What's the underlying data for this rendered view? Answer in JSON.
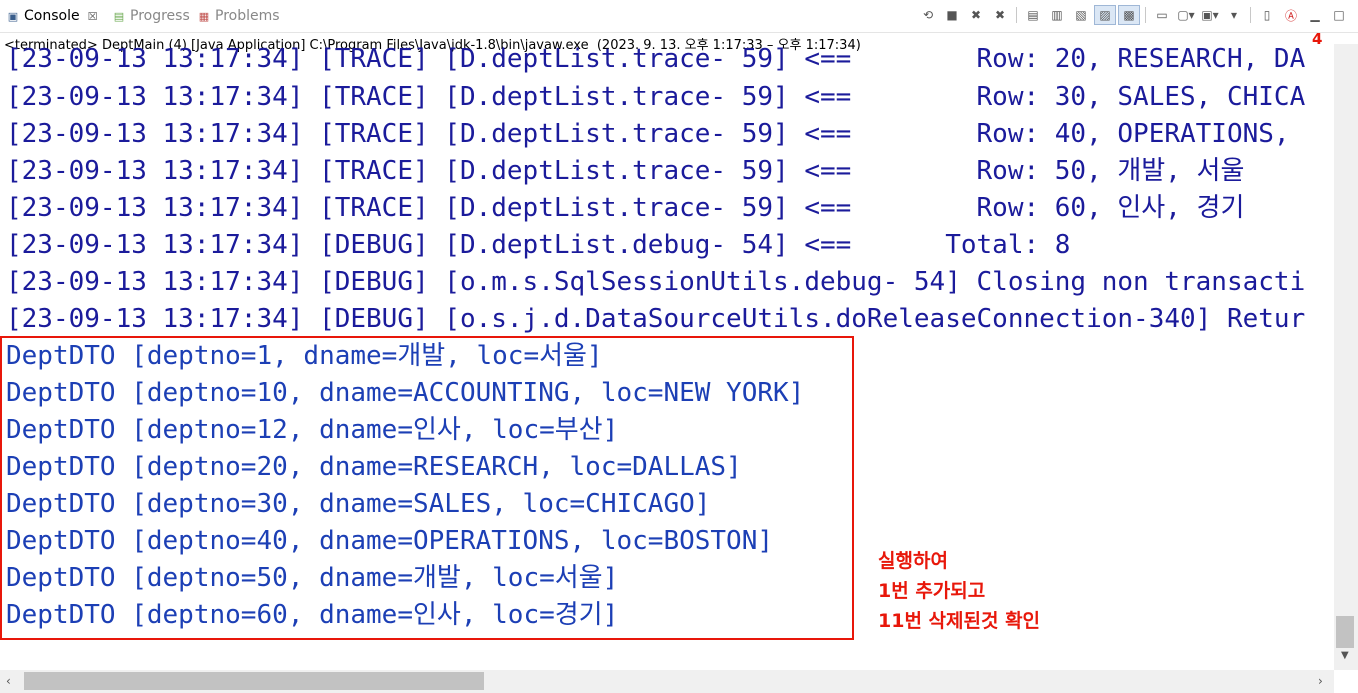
{
  "tabs": [
    {
      "label": "Console",
      "icon": "console-icon",
      "active": true
    },
    {
      "label": "Progress",
      "icon": "progress-icon",
      "active": false
    },
    {
      "label": "Problems",
      "icon": "problems-icon",
      "active": false
    }
  ],
  "close_glyph": "☒",
  "status_line": "<terminated> DeptMain (4) [Java Application] C:\\Program Files\\Java\\jdk-1.8\\bin\\javaw.exe  (2023. 9. 13. 오후 1:17:33 – 오후 1:17:34)",
  "badge": "4",
  "toolbar_icons": [
    "pin-icon",
    "stop-icon",
    "remove-launch-icon",
    "remove-all-icon",
    "scroll-lock-icon",
    "word-wrap-icon",
    "show-stdout-icon",
    "show-stderr-icon",
    "open-console-icon",
    "display-console-icon",
    "new-console-icon",
    "view-menu-icon",
    "minimize-icon",
    "maximize-icon"
  ],
  "log_lines": [
    "[23-09-13 13:17:34] [TRACE] [D.deptList.trace- 59] <==        Row: 20, RESEARCH, DA",
    "[23-09-13 13:17:34] [TRACE] [D.deptList.trace- 59] <==        Row: 30, SALES, CHICA",
    "[23-09-13 13:17:34] [TRACE] [D.deptList.trace- 59] <==        Row: 40, OPERATIONS, ",
    "[23-09-13 13:17:34] [TRACE] [D.deptList.trace- 59] <==        Row: 50, 개발, 서울",
    "[23-09-13 13:17:34] [TRACE] [D.deptList.trace- 59] <==        Row: 60, 인사, 경기",
    "[23-09-13 13:17:34] [DEBUG] [D.deptList.debug- 54] <==      Total: 8",
    "[23-09-13 13:17:34] [DEBUG] [o.m.s.SqlSessionUtils.debug- 54] Closing non transacti",
    "[23-09-13 13:17:34] [DEBUG] [o.s.j.d.DataSourceUtils.doReleaseConnection-340] Retur"
  ],
  "output_lines": [
    "DeptDTO [deptno=1, dname=개발, loc=서울]",
    "DeptDTO [deptno=10, dname=ACCOUNTING, loc=NEW YORK]",
    "DeptDTO [deptno=12, dname=인사, loc=부산]",
    "DeptDTO [deptno=20, dname=RESEARCH, loc=DALLAS]",
    "DeptDTO [deptno=30, dname=SALES, loc=CHICAGO]",
    "DeptDTO [deptno=40, dname=OPERATIONS, loc=BOSTON]",
    "DeptDTO [deptno=50, dname=개발, loc=서울]",
    "DeptDTO [deptno=60, dname=인사, loc=경기]"
  ],
  "annotation": [
    "실행하여",
    "1번 추가되고",
    "11번 삭제된것 확인"
  ],
  "colors": {
    "log_text": "#1b1b9b",
    "output_text": "#1c3fb5",
    "annotation": "#e8170a"
  }
}
